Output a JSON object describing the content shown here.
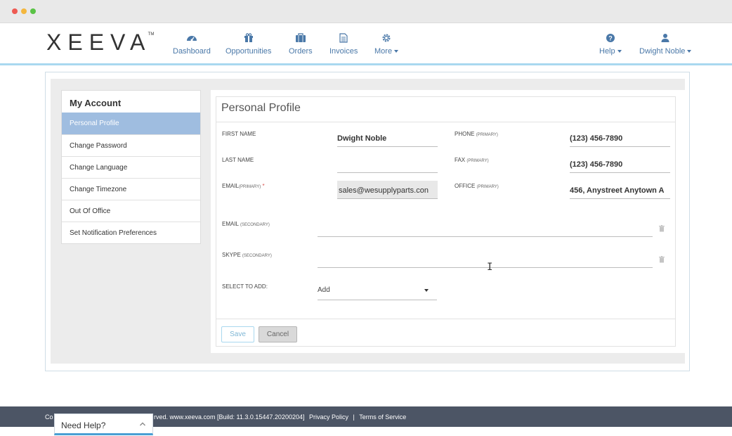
{
  "header": {
    "logo": "XEEVA",
    "logo_tm": "TM",
    "nav": [
      {
        "label": "Dashboard",
        "icon": "dashboard-icon"
      },
      {
        "label": "Opportunities",
        "icon": "gift-icon"
      },
      {
        "label": "Orders",
        "icon": "briefcase-icon"
      },
      {
        "label": "Invoices",
        "icon": "document-icon"
      },
      {
        "label": "More",
        "icon": "gear-icon"
      }
    ],
    "help_label": "Help",
    "user_label": "Dwight Noble"
  },
  "sidebar": {
    "title": "My Account",
    "items": [
      {
        "label": "Personal Profile",
        "active": true
      },
      {
        "label": "Change Password"
      },
      {
        "label": "Change Language"
      },
      {
        "label": "Change Timezone"
      },
      {
        "label": "Out Of Office"
      },
      {
        "label": "Set Notification Preferences"
      }
    ]
  },
  "profile": {
    "title": "Personal Profile",
    "first_name_label": "FIRST NAME",
    "first_name": "Dwight Noble",
    "last_name_label": "LAST NAME",
    "last_name": "",
    "email_label": "EMAIL",
    "email_qual": "(PRIMARY)",
    "email_req": "*",
    "email": "sales@wesupplyparts.con",
    "phone_label": "PHONE",
    "phone_qual": "(PRIMARY)",
    "phone": "(123) 456-7890",
    "fax_label": "FAX",
    "fax_qual": "(PRIMARY)",
    "fax": "(123) 456-7890",
    "office_label": "OFFICE",
    "office_qual": "(PRIMARY)",
    "office": "456, Anystreet  Anytown  A",
    "email2_label": "EMAIL",
    "email2_qual": "(SECONDARY)",
    "email2": "",
    "skype_label": "SKYPE",
    "skype_qual": "(SECONDARY)",
    "skype": "",
    "select_label": "SELECT TO ADD:",
    "select_value": "Add",
    "save_label": "Save",
    "cancel_label": "Cancel"
  },
  "footer": {
    "prefix": "Co",
    "text": "rved. www.xeeva.com [Build: 11.3.0.15447.20200204]",
    "privacy": "Privacy Policy",
    "separator": "|",
    "terms": "Terms of Service"
  },
  "help_widget": {
    "label": "Need Help?"
  },
  "colors": {
    "nav_blue": "#4a78a8",
    "active_item": "#9fbde0",
    "footer_bg": "#4c5565",
    "header_rule": "#a9d8ef"
  }
}
